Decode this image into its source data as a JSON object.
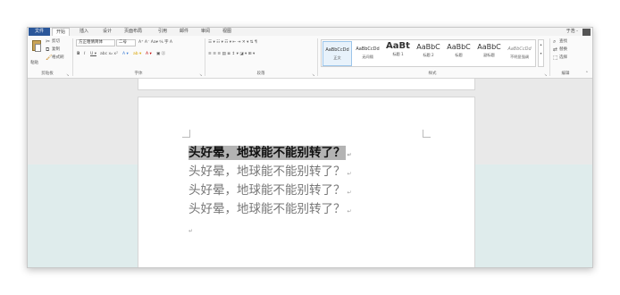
{
  "tabs": [
    {
      "label": "文件"
    },
    {
      "label": "开始"
    },
    {
      "label": "插入"
    },
    {
      "label": "设计"
    },
    {
      "label": "页面布局"
    },
    {
      "label": "引用"
    },
    {
      "label": "邮件"
    },
    {
      "label": "审阅"
    },
    {
      "label": "视图"
    }
  ],
  "user": {
    "name": "于浩 -"
  },
  "clipboard": {
    "paste_label": "粘贴",
    "cut_label": "剪切",
    "copy_label": "复制",
    "format_painter_label": "格式刷",
    "group_label": "剪贴板"
  },
  "font": {
    "family": "方正粗倩简体",
    "size": "二号",
    "group_label": "字体"
  },
  "paragraph": {
    "group_label": "段落"
  },
  "styles": {
    "items": [
      {
        "sample": "AaBbCcDd",
        "name": "正文"
      },
      {
        "sample": "AaBbCcDd",
        "name": "无间隔"
      },
      {
        "sample": "AaBt",
        "name": "标题 1"
      },
      {
        "sample": "AaBbC",
        "name": "标题 2"
      },
      {
        "sample": "AaBbC",
        "name": "标题"
      },
      {
        "sample": "AaBbC",
        "name": "副标题"
      },
      {
        "sample": "AaBbCcDd",
        "name": "不明显强调"
      }
    ],
    "group_label": "样式"
  },
  "editing": {
    "find_label": "查找",
    "replace_label": "替换",
    "select_label": "选择",
    "group_label": "编辑"
  },
  "document": {
    "lines": [
      "头好晕，地球能不能别转了？",
      "头好晕，地球能不能别转了？",
      "头好晕，地球能不能别转了？",
      "头好晕，地球能不能别转了？"
    ],
    "paragraph_mark": "↵"
  }
}
